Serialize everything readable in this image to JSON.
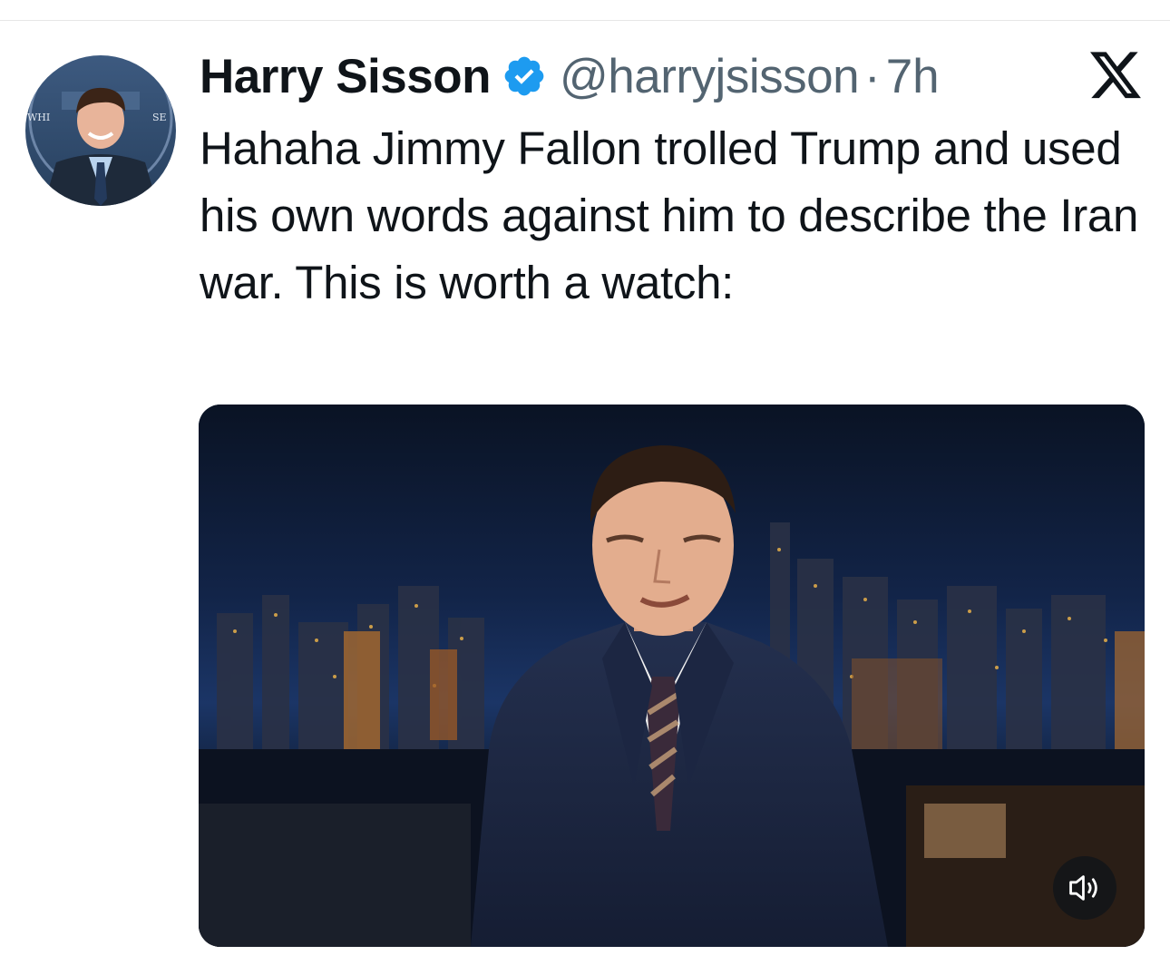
{
  "tweet": {
    "author_name": "Harry Sisson",
    "handle": "@harryjsisson",
    "separator": "·",
    "time": "7h",
    "text": "Hahaha Jimmy Fallon trolled Trump and used his own words against him to describe the Iran war. This is worth a watch:",
    "verified": true
  },
  "avatar": {
    "sign_text_left": "WHI",
    "sign_text_right": "SE"
  },
  "icons": {
    "verified": "verified-badge-icon",
    "platform": "x-logo-icon",
    "mute": "speaker-icon"
  },
  "colors": {
    "verified_blue": "#1d9bf0",
    "text_primary": "#0f1419",
    "text_secondary": "#536471"
  },
  "media": {
    "type": "video",
    "muted": true
  }
}
